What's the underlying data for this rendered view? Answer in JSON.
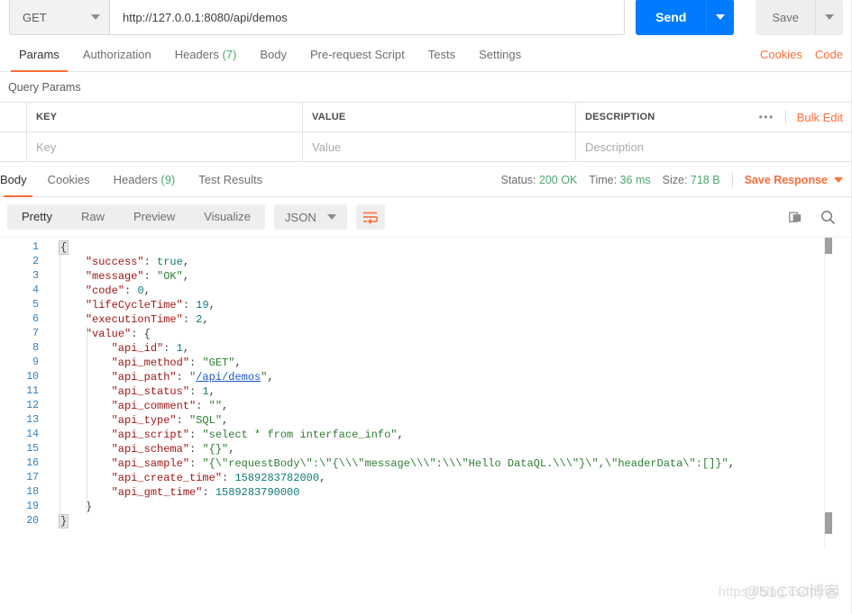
{
  "request": {
    "method": "GET",
    "url": "http://127.0.0.1:8080/api/demos",
    "send_label": "Send",
    "save_label": "Save",
    "tabs": [
      {
        "label": "Params",
        "active": true
      },
      {
        "label": "Authorization",
        "active": false
      },
      {
        "label": "Headers",
        "count": "(7)",
        "active": false
      },
      {
        "label": "Body",
        "active": false
      },
      {
        "label": "Pre-request Script",
        "active": false
      },
      {
        "label": "Tests",
        "active": false
      },
      {
        "label": "Settings",
        "active": false
      }
    ],
    "cookies_link": "Cookies",
    "code_link": "Code"
  },
  "query_params": {
    "title": "Query Params",
    "columns": [
      "KEY",
      "VALUE",
      "DESCRIPTION"
    ],
    "placeholders": [
      "Key",
      "Value",
      "Description"
    ],
    "more_icon": "•••",
    "bulk_edit": "Bulk Edit"
  },
  "response": {
    "tabs": [
      {
        "label": "Body",
        "active": true
      },
      {
        "label": "Cookies",
        "active": false
      },
      {
        "label": "Headers",
        "count": "(9)",
        "active": false
      },
      {
        "label": "Test Results",
        "active": false
      }
    ],
    "status_label": "Status:",
    "status_value": "200 OK",
    "time_label": "Time:",
    "time_value": "36 ms",
    "size_label": "Size:",
    "size_value": "718 B",
    "save_response": "Save Response",
    "view_modes": [
      {
        "label": "Pretty",
        "active": true
      },
      {
        "label": "Raw",
        "active": false
      },
      {
        "label": "Preview",
        "active": false
      },
      {
        "label": "Visualize",
        "active": false
      }
    ],
    "format": "JSON"
  },
  "colors": {
    "accent": "#ff6c37",
    "send": "#007bff",
    "status_green": "#4aa96c",
    "link_blue": "#1a56c4"
  },
  "code_lines": [
    {
      "n": "1",
      "indent": 0,
      "selected": true,
      "tokens": [
        {
          "t": "{",
          "c": "p"
        }
      ]
    },
    {
      "n": "2",
      "indent": 1,
      "tokens": [
        {
          "t": "\"success\"",
          "c": "k"
        },
        {
          "t": ": ",
          "c": "p"
        },
        {
          "t": "true",
          "c": "b"
        },
        {
          "t": ",",
          "c": "p"
        }
      ]
    },
    {
      "n": "3",
      "indent": 1,
      "tokens": [
        {
          "t": "\"message\"",
          "c": "k"
        },
        {
          "t": ": ",
          "c": "p"
        },
        {
          "t": "\"OK\"",
          "c": "s"
        },
        {
          "t": ",",
          "c": "p"
        }
      ]
    },
    {
      "n": "4",
      "indent": 1,
      "tokens": [
        {
          "t": "\"code\"",
          "c": "k"
        },
        {
          "t": ": ",
          "c": "p"
        },
        {
          "t": "0",
          "c": "n"
        },
        {
          "t": ",",
          "c": "p"
        }
      ]
    },
    {
      "n": "5",
      "indent": 1,
      "tokens": [
        {
          "t": "\"lifeCycleTime\"",
          "c": "k"
        },
        {
          "t": ": ",
          "c": "p"
        },
        {
          "t": "19",
          "c": "n"
        },
        {
          "t": ",",
          "c": "p"
        }
      ]
    },
    {
      "n": "6",
      "indent": 1,
      "tokens": [
        {
          "t": "\"executionTime\"",
          "c": "k"
        },
        {
          "t": ": ",
          "c": "p"
        },
        {
          "t": "2",
          "c": "n"
        },
        {
          "t": ",",
          "c": "p"
        }
      ]
    },
    {
      "n": "7",
      "indent": 1,
      "tokens": [
        {
          "t": "\"value\"",
          "c": "k"
        },
        {
          "t": ": {",
          "c": "p"
        }
      ]
    },
    {
      "n": "8",
      "indent": 2,
      "tokens": [
        {
          "t": "\"api_id\"",
          "c": "k"
        },
        {
          "t": ": ",
          "c": "p"
        },
        {
          "t": "1",
          "c": "n"
        },
        {
          "t": ",",
          "c": "p"
        }
      ]
    },
    {
      "n": "9",
      "indent": 2,
      "tokens": [
        {
          "t": "\"api_method\"",
          "c": "k"
        },
        {
          "t": ": ",
          "c": "p"
        },
        {
          "t": "\"GET\"",
          "c": "s"
        },
        {
          "t": ",",
          "c": "p"
        }
      ]
    },
    {
      "n": "10",
      "indent": 2,
      "tokens": [
        {
          "t": "\"api_path\"",
          "c": "k"
        },
        {
          "t": ": ",
          "c": "p"
        },
        {
          "t": "\"",
          "c": "s"
        },
        {
          "t": "/api/demos",
          "c": "lnk"
        },
        {
          "t": "\"",
          "c": "s"
        },
        {
          "t": ",",
          "c": "p"
        }
      ]
    },
    {
      "n": "11",
      "indent": 2,
      "tokens": [
        {
          "t": "\"api_status\"",
          "c": "k"
        },
        {
          "t": ": ",
          "c": "p"
        },
        {
          "t": "1",
          "c": "n"
        },
        {
          "t": ",",
          "c": "p"
        }
      ]
    },
    {
      "n": "12",
      "indent": 2,
      "tokens": [
        {
          "t": "\"api_comment\"",
          "c": "k"
        },
        {
          "t": ": ",
          "c": "p"
        },
        {
          "t": "\"\"",
          "c": "s"
        },
        {
          "t": ",",
          "c": "p"
        }
      ]
    },
    {
      "n": "13",
      "indent": 2,
      "tokens": [
        {
          "t": "\"api_type\"",
          "c": "k"
        },
        {
          "t": ": ",
          "c": "p"
        },
        {
          "t": "\"SQL\"",
          "c": "s"
        },
        {
          "t": ",",
          "c": "p"
        }
      ]
    },
    {
      "n": "14",
      "indent": 2,
      "tokens": [
        {
          "t": "\"api_script\"",
          "c": "k"
        },
        {
          "t": ": ",
          "c": "p"
        },
        {
          "t": "\"select * from interface_info\"",
          "c": "s"
        },
        {
          "t": ",",
          "c": "p"
        }
      ]
    },
    {
      "n": "15",
      "indent": 2,
      "tokens": [
        {
          "t": "\"api_schema\"",
          "c": "k"
        },
        {
          "t": ": ",
          "c": "p"
        },
        {
          "t": "\"{}\"",
          "c": "s"
        },
        {
          "t": ",",
          "c": "p"
        }
      ]
    },
    {
      "n": "16",
      "indent": 2,
      "tokens": [
        {
          "t": "\"api_sample\"",
          "c": "k"
        },
        {
          "t": ": ",
          "c": "p"
        },
        {
          "t": "\"{\\\"requestBody\\\":\\\"{\\\\\\\"message\\\\\\\":\\\\\\\"Hello DataQL.\\\\\\\"}\\\",\\\"headerData\\\":[]}\"",
          "c": "s"
        },
        {
          "t": ",",
          "c": "p"
        }
      ]
    },
    {
      "n": "17",
      "indent": 2,
      "tokens": [
        {
          "t": "\"api_create_time\"",
          "c": "k"
        },
        {
          "t": ": ",
          "c": "p"
        },
        {
          "t": "1589283782000",
          "c": "n"
        },
        {
          "t": ",",
          "c": "p"
        }
      ]
    },
    {
      "n": "18",
      "indent": 2,
      "tokens": [
        {
          "t": "\"api_gmt_time\"",
          "c": "k"
        },
        {
          "t": ": ",
          "c": "p"
        },
        {
          "t": "1589283790000",
          "c": "n"
        }
      ]
    },
    {
      "n": "19",
      "indent": 1,
      "tokens": [
        {
          "t": "}",
          "c": "p"
        }
      ]
    },
    {
      "n": "20",
      "indent": 0,
      "selected": true,
      "tokens": [
        {
          "t": "}",
          "c": "p"
        }
      ]
    }
  ],
  "watermarks": {
    "blog": "https://blog.csdn.net",
    "site": "@51CTO博客"
  }
}
